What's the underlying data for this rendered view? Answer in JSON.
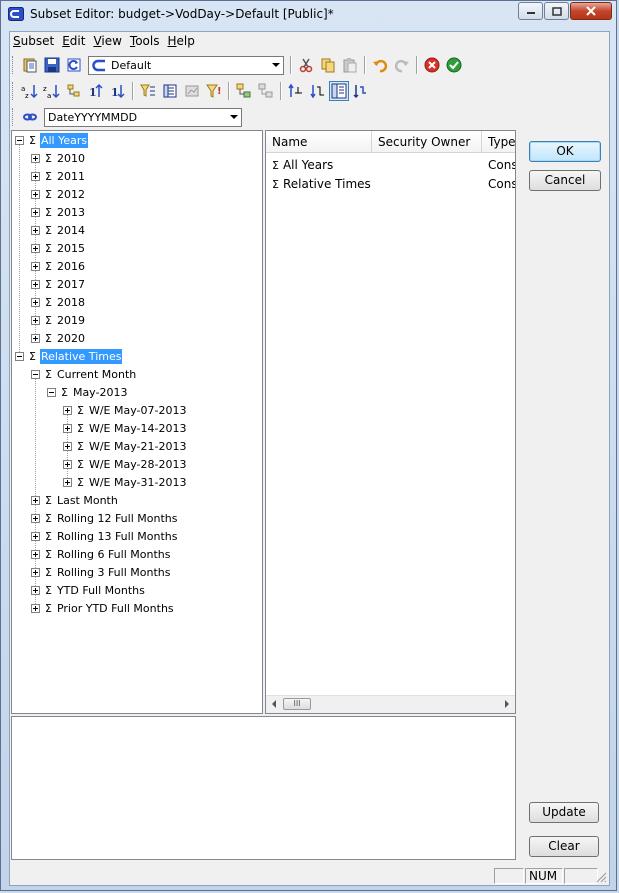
{
  "window": {
    "title": "Subset Editor:  budget->VodDay->Default  [Public]*"
  },
  "menubar": {
    "items": [
      {
        "label": "Subset",
        "ul": "S",
        "rest": "ubset"
      },
      {
        "label": "Edit",
        "ul": "E",
        "rest": "dit"
      },
      {
        "label": "View",
        "ul": "V",
        "rest": "iew"
      },
      {
        "label": "Tools",
        "ul": "T",
        "rest": "ools"
      },
      {
        "label": "Help",
        "ul": "H",
        "rest": "elp"
      }
    ]
  },
  "toolbar": {
    "subset_combo": "Default",
    "attribute_combo": "DateYYYYMMDD"
  },
  "tree": {
    "items": [
      {
        "label": "All Years",
        "level": 0,
        "toggle": "minus",
        "selected": true
      },
      {
        "label": "2010",
        "level": 1,
        "toggle": "plus"
      },
      {
        "label": "2011",
        "level": 1,
        "toggle": "plus"
      },
      {
        "label": "2012",
        "level": 1,
        "toggle": "plus"
      },
      {
        "label": "2013",
        "level": 1,
        "toggle": "plus"
      },
      {
        "label": "2014",
        "level": 1,
        "toggle": "plus"
      },
      {
        "label": "2015",
        "level": 1,
        "toggle": "plus"
      },
      {
        "label": "2016",
        "level": 1,
        "toggle": "plus"
      },
      {
        "label": "2017",
        "level": 1,
        "toggle": "plus"
      },
      {
        "label": "2018",
        "level": 1,
        "toggle": "plus"
      },
      {
        "label": "2019",
        "level": 1,
        "toggle": "plus"
      },
      {
        "label": "2020",
        "level": 1,
        "toggle": "plus"
      },
      {
        "label": "Relative Times",
        "level": 0,
        "toggle": "minus",
        "selected": true
      },
      {
        "label": "Current Month",
        "level": 1,
        "toggle": "minus"
      },
      {
        "label": "May-2013",
        "level": 2,
        "toggle": "minus"
      },
      {
        "label": "W/E May-07-2013",
        "level": 3,
        "toggle": "plus"
      },
      {
        "label": "W/E May-14-2013",
        "level": 3,
        "toggle": "plus"
      },
      {
        "label": "W/E May-21-2013",
        "level": 3,
        "toggle": "plus"
      },
      {
        "label": "W/E May-28-2013",
        "level": 3,
        "toggle": "plus"
      },
      {
        "label": "W/E May-31-2013",
        "level": 3,
        "toggle": "plus"
      },
      {
        "label": "Last Month",
        "level": 1,
        "toggle": "plus"
      },
      {
        "label": "Rolling 12 Full Months",
        "level": 1,
        "toggle": "plus"
      },
      {
        "label": "Rolling 13 Full Months",
        "level": 1,
        "toggle": "plus"
      },
      {
        "label": "Rolling 6 Full Months",
        "level": 1,
        "toggle": "plus"
      },
      {
        "label": "Rolling 3 Full Months",
        "level": 1,
        "toggle": "plus"
      },
      {
        "label": "YTD Full Months",
        "level": 1,
        "toggle": "plus"
      },
      {
        "label": "Prior YTD Full Months",
        "level": 1,
        "toggle": "plus"
      }
    ]
  },
  "list": {
    "columns": [
      "Name",
      "Security Owner",
      "Type"
    ],
    "rows": [
      {
        "name": "All Years",
        "owner": "",
        "type": "Cons"
      },
      {
        "name": "Relative Times",
        "owner": "",
        "type": "Cons"
      }
    ],
    "scroll_thumb": "III"
  },
  "buttons": {
    "ok": "OK",
    "cancel": "Cancel",
    "update": "Update",
    "clear": "Clear"
  },
  "statusbar": {
    "num": "NUM"
  }
}
